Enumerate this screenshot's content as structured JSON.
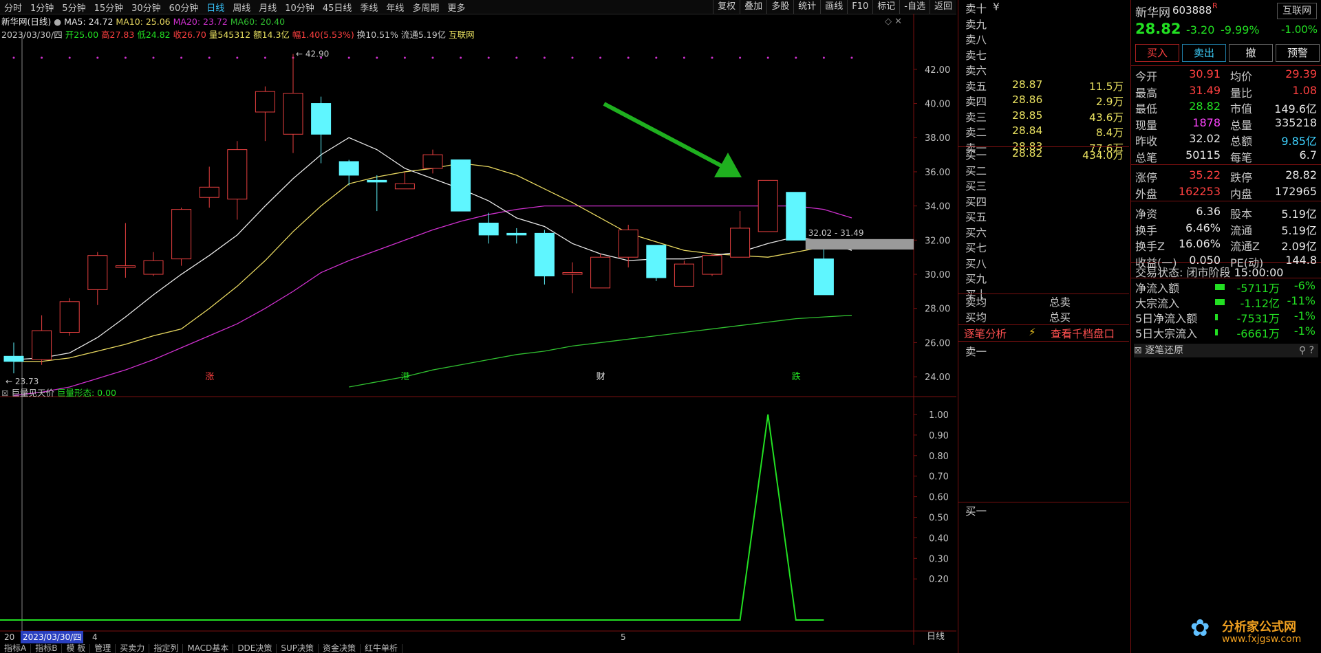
{
  "toolbar": {
    "tabs": [
      "分时",
      "1分钟",
      "5分钟",
      "15分钟",
      "30分钟",
      "60分钟",
      "日线",
      "周线",
      "月线",
      "10分钟",
      "45日线",
      "季线",
      "年线",
      "多周期",
      "更多"
    ],
    "active_tab": "日线",
    "right_buttons": [
      "复权",
      "叠加",
      "多股",
      "统计",
      "画线",
      "F10",
      "标记",
      "-自选",
      "返回"
    ]
  },
  "chart": {
    "title": "新华网(日线)",
    "ma_line": [
      "MA5: 24.72",
      "MA10: 25.06",
      "MA20: 23.72",
      "MA60: 20.40"
    ],
    "info_date": "2023/03/30/四",
    "info_values": [
      "开25.00",
      "高27.83",
      "低24.82",
      "收26.70",
      "量545312",
      "额14.3亿",
      "幅1.40(5.53%)",
      "换10.51%",
      "流通5.19亿",
      "互联网"
    ],
    "high_marker": "42.90",
    "low_marker": "23.73",
    "range_label": "32.02 - 31.49",
    "event_marks": [
      "涨",
      "港",
      "财",
      "跌"
    ],
    "y_ticks": [
      "42.00",
      "40.00",
      "38.00",
      "36.00",
      "34.00",
      "32.00",
      "30.00",
      "28.00",
      "26.00",
      "24.00"
    ],
    "ind_title": "巨量见天价",
    "ind_label": "巨量形态: 0.00",
    "ind_y_ticks": [
      "1.00",
      "0.90",
      "0.80",
      "0.70",
      "0.60",
      "0.50",
      "0.40",
      "0.30",
      "0.20"
    ],
    "bottom_date_prefix": "20",
    "bottom_date": "2023/03/30/四",
    "bottom_month_4": "4",
    "bottom_month_5": "5",
    "period_label": "日线"
  },
  "chart_data": {
    "type": "candlestick",
    "candles": [
      {
        "o": 25.2,
        "h": 26.0,
        "l": 24.2,
        "c": 24.9
      },
      {
        "o": 25.0,
        "h": 27.6,
        "l": 24.7,
        "c": 26.7
      },
      {
        "o": 26.6,
        "h": 28.6,
        "l": 26.4,
        "c": 28.4
      },
      {
        "o": 29.1,
        "h": 31.3,
        "l": 28.2,
        "c": 31.1
      },
      {
        "o": 30.4,
        "h": 33.0,
        "l": 29.8,
        "c": 30.5
      },
      {
        "o": 30.0,
        "h": 31.3,
        "l": 29.9,
        "c": 30.8
      },
      {
        "o": 30.9,
        "h": 33.9,
        "l": 30.5,
        "c": 33.8
      },
      {
        "o": 34.5,
        "h": 36.3,
        "l": 33.9,
        "c": 35.1
      },
      {
        "o": 34.4,
        "h": 37.8,
        "l": 33.2,
        "c": 37.3
      },
      {
        "o": 39.5,
        "h": 41.0,
        "l": 37.8,
        "c": 40.7
      },
      {
        "o": 38.2,
        "h": 42.9,
        "l": 37.1,
        "c": 40.6
      },
      {
        "o": 40.0,
        "h": 40.4,
        "l": 36.5,
        "c": 38.2
      },
      {
        "o": 36.6,
        "h": 36.7,
        "l": 35.2,
        "c": 35.8
      },
      {
        "o": 35.5,
        "h": 35.8,
        "l": 33.7,
        "c": 35.4
      },
      {
        "o": 35.0,
        "h": 36.0,
        "l": 35.0,
        "c": 35.3
      },
      {
        "o": 36.2,
        "h": 37.3,
        "l": 35.9,
        "c": 37.0
      },
      {
        "o": 36.7,
        "h": 36.7,
        "l": 33.7,
        "c": 33.7
      },
      {
        "o": 33.0,
        "h": 33.6,
        "l": 31.8,
        "c": 32.3
      },
      {
        "o": 32.4,
        "h": 32.7,
        "l": 31.8,
        "c": 32.3
      },
      {
        "o": 32.4,
        "h": 32.6,
        "l": 29.4,
        "c": 29.9
      },
      {
        "o": 30.0,
        "h": 30.7,
        "l": 28.9,
        "c": 30.1
      },
      {
        "o": 29.2,
        "h": 31.2,
        "l": 29.2,
        "c": 31.0
      },
      {
        "o": 31.0,
        "h": 32.9,
        "l": 30.4,
        "c": 32.6
      },
      {
        "o": 31.7,
        "h": 31.7,
        "l": 29.6,
        "c": 29.8
      },
      {
        "o": 29.3,
        "h": 30.8,
        "l": 29.3,
        "c": 30.6
      },
      {
        "o": 30.0,
        "h": 31.2,
        "l": 29.9,
        "c": 31.1
      },
      {
        "o": 31.0,
        "h": 33.7,
        "l": 31.0,
        "c": 32.7
      },
      {
        "o": 32.5,
        "h": 35.5,
        "l": 32.5,
        "c": 35.5
      },
      {
        "o": 34.8,
        "h": 34.8,
        "l": 32.0,
        "c": 32.0
      },
      {
        "o": 30.9,
        "h": 31.5,
        "l": 28.8,
        "c": 28.8
      }
    ],
    "ma5": [
      25.0,
      25.1,
      25.4,
      26.3,
      27.5,
      28.8,
      30.0,
      31.1,
      32.3,
      34.0,
      35.6,
      37.0,
      38.0,
      37.3,
      36.2,
      35.6,
      35.0,
      34.3,
      33.3,
      32.8,
      31.8,
      31.2,
      30.8,
      30.9,
      30.9,
      31.1,
      31.3,
      31.8,
      32.2,
      31.9,
      31.4
    ],
    "ma10": [
      24.9,
      24.9,
      25.1,
      25.5,
      25.9,
      26.4,
      26.8,
      28.0,
      29.3,
      30.8,
      32.5,
      34.0,
      35.3,
      35.7,
      36.0,
      36.2,
      36.5,
      36.3,
      35.8,
      35.0,
      34.2,
      33.3,
      32.4,
      31.9,
      31.4,
      31.2,
      31.1,
      31.0,
      31.3,
      31.6,
      31.5
    ],
    "ma20": [
      22.9,
      23.1,
      23.4,
      23.9,
      24.4,
      25.0,
      25.7,
      26.4,
      27.1,
      28.0,
      29.0,
      30.1,
      30.8,
      31.4,
      32.0,
      32.6,
      33.1,
      33.5,
      33.8,
      34.0,
      34.0,
      34.0,
      34.0,
      34.0,
      34.0,
      34.0,
      34.0,
      34.0,
      34.0,
      33.8,
      33.3
    ],
    "ma60_start_index": 12,
    "ma60": [
      23.4,
      23.7,
      24.0,
      24.4,
      24.7,
      25.0,
      25.3,
      25.5,
      25.8,
      26.0,
      26.2,
      26.4,
      26.6,
      26.8,
      27.0,
      27.2,
      27.4,
      27.5,
      27.6
    ],
    "ylim": [
      23.2,
      43.0
    ],
    "indicator": [
      0,
      0,
      0,
      0,
      0,
      0,
      0,
      0,
      0,
      0,
      0,
      0,
      0,
      0,
      0,
      0,
      0,
      0,
      0,
      0,
      0,
      0,
      0,
      0,
      0,
      0,
      0,
      1,
      0,
      0
    ],
    "indicator_ylim": [
      0,
      1.0
    ]
  },
  "colors": {
    "up": "#e84040",
    "down": "#5ff6ff",
    "ma5": "#e8e8e8",
    "ma10": "#e8d860",
    "ma20": "#d030d0",
    "ma60": "#30c030",
    "indicator": "#22e022",
    "arrow": "#1fb01f"
  },
  "book": {
    "sells": [
      {
        "label": "卖十",
        "price": "",
        "vol": ""
      },
      {
        "label": "卖九",
        "price": "",
        "vol": ""
      },
      {
        "label": "卖八",
        "price": "",
        "vol": ""
      },
      {
        "label": "卖七",
        "price": "",
        "vol": ""
      },
      {
        "label": "卖六",
        "price": "",
        "vol": ""
      },
      {
        "label": "卖五",
        "price": "28.87",
        "vol": "11.5万"
      },
      {
        "label": "卖四",
        "price": "28.86",
        "vol": "2.9万"
      },
      {
        "label": "卖三",
        "price": "28.85",
        "vol": "43.6万"
      },
      {
        "label": "卖二",
        "price": "28.84",
        "vol": "8.4万"
      },
      {
        "label": "卖一",
        "price": "28.83",
        "vol": "77.6万"
      }
    ],
    "sell_top_suffix": "¥",
    "buys": [
      {
        "label": "买一",
        "price": "28.82",
        "vol": "434.0万"
      },
      {
        "label": "买二",
        "price": "",
        "vol": ""
      },
      {
        "label": "买三",
        "price": "",
        "vol": ""
      },
      {
        "label": "买四",
        "price": "",
        "vol": ""
      },
      {
        "label": "买五",
        "price": "",
        "vol": ""
      },
      {
        "label": "买六",
        "price": "",
        "vol": ""
      },
      {
        "label": "买七",
        "price": "",
        "vol": ""
      },
      {
        "label": "买八",
        "price": "",
        "vol": ""
      },
      {
        "label": "买九",
        "price": "",
        "vol": ""
      },
      {
        "label": "买十",
        "price": "",
        "vol": ""
      }
    ],
    "avg_sell": "卖均",
    "total_sell": "总卖",
    "avg_buy": "买均",
    "total_buy": "总买",
    "trade_analysis": "逐笔分析",
    "depth_link": "查看千档盘口",
    "sell1_panel": "卖一",
    "buy1_panel": "买一"
  },
  "quote": {
    "name": "新华网",
    "code": "603888",
    "r_badge": "R",
    "sector": "互联网",
    "price": "28.82",
    "change": "-3.20",
    "pct": "-9.99%",
    "sector_pct": "-1.00%",
    "buttons": [
      "买入",
      "卖出",
      "撤",
      "预警"
    ],
    "rows": [
      [
        "今开",
        "30.91",
        "均价",
        "29.39"
      ],
      [
        "最高",
        "31.49",
        "量比",
        "1.08"
      ],
      [
        "最低",
        "28.82",
        "市值",
        "149.6亿"
      ],
      [
        "现量",
        "1878",
        "总量",
        "335218"
      ],
      [
        "昨收",
        "32.02",
        "总额",
        "9.85亿"
      ],
      [
        "总笔",
        "50115",
        "每笔",
        "6.7"
      ],
      [
        "涨停",
        "35.22",
        "跌停",
        "28.82"
      ],
      [
        "外盘",
        "162253",
        "内盘",
        "172965"
      ],
      [
        "净资",
        "6.36",
        "股本",
        "5.19亿"
      ],
      [
        "换手",
        "6.46%",
        "流通",
        "5.19亿"
      ],
      [
        "换手Z",
        "16.06%",
        "流通Z",
        "2.09亿"
      ],
      [
        "收益(一)",
        "0.050",
        "PE(动)",
        "144.8"
      ]
    ],
    "status_label": "交易状态: 闭市阶段",
    "status_time": "15:00:00",
    "flows": [
      [
        "净流入额",
        "-5711万",
        "-6%"
      ],
      [
        "大宗流入",
        "-1.12亿",
        "-11%"
      ],
      [
        "5日净流入额",
        "-7531万",
        "-1%"
      ],
      [
        "5日大宗流入",
        "-6661万",
        "-1%"
      ]
    ],
    "trade_restore": "逐笔还原",
    "watermark": "分析家公式网",
    "watermark_url": "www.fxjgsw.com"
  },
  "bottom_tabs": [
    "指标A",
    "指标B",
    "模 板",
    "管理",
    "买卖力",
    "指定列",
    "MACD基本",
    "DDE决策",
    "SUP决策",
    "资金决策",
    "红牛单析"
  ]
}
